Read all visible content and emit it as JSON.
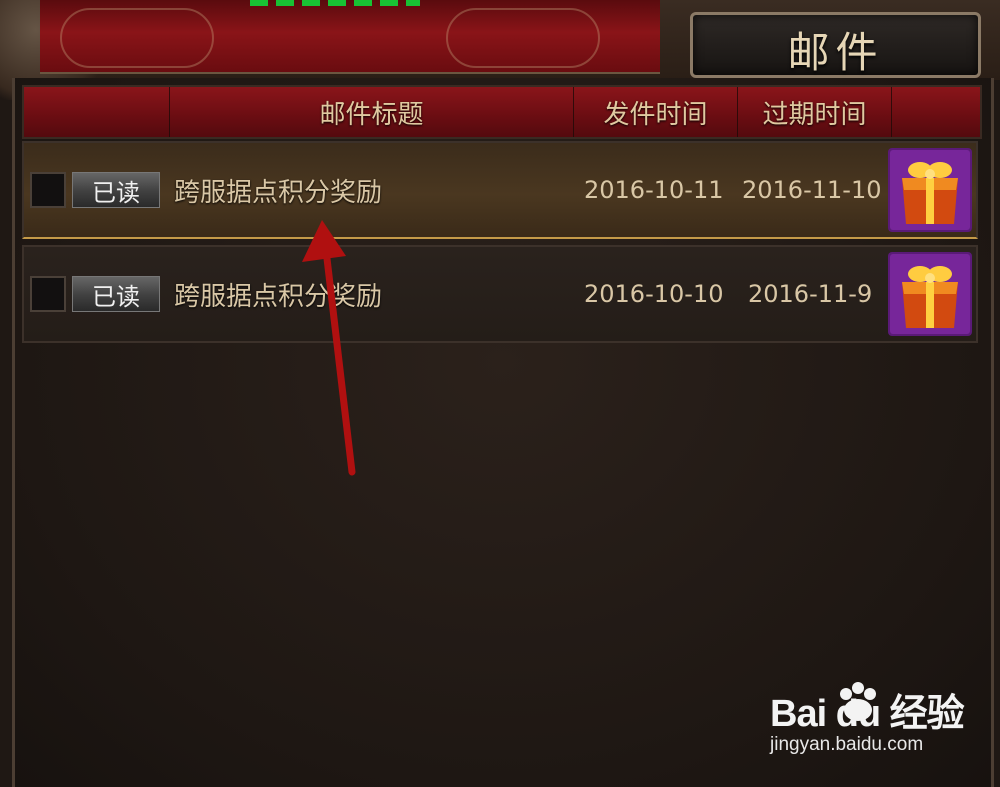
{
  "window": {
    "title": "邮件"
  },
  "table": {
    "headers": [
      "",
      "邮件标题",
      "发件时间",
      "过期时间",
      ""
    ]
  },
  "mails": [
    {
      "status": "已读",
      "subject": "跨服据点积分奖励",
      "send_time": "2016-10-11",
      "expire_time": "2016-11-10",
      "attachment": "gift-box-icon",
      "selected": true
    },
    {
      "status": "已读",
      "subject": "跨服据点积分奖励",
      "send_time": "2016-10-10",
      "expire_time": "2016-11-9",
      "attachment": "gift-box-icon",
      "selected": false
    }
  ],
  "annotation": {
    "arrow_color": "#b01010",
    "points_to": "mail-subject"
  },
  "watermark": {
    "logo": "Bai du 经验",
    "url": "jingyan.baidu.com"
  },
  "colors": {
    "header_red": "#8a151a",
    "selected_gold": "#c49a48",
    "text_gold": "#d9c7a6"
  }
}
